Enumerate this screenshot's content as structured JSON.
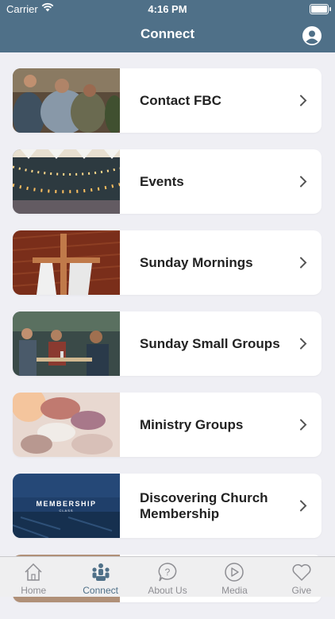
{
  "status_bar": {
    "carrier": "Carrier",
    "time": "4:16 PM"
  },
  "nav": {
    "title": "Connect",
    "profile_icon": "person-icon"
  },
  "items": [
    {
      "label": "Contact FBC",
      "image": "people-hugging-photo"
    },
    {
      "label": "Events",
      "image": "string-lights-photo"
    },
    {
      "label": "Sunday Mornings",
      "image": "cross-on-wall-photo"
    },
    {
      "label": "Sunday Small Groups",
      "image": "people-at-table-photo"
    },
    {
      "label": "Ministry Groups",
      "image": "hands-together-photo"
    },
    {
      "label": "Discovering Church Membership",
      "image": "membership-class-photo",
      "image_text": "MEMBERSHIP",
      "image_subtext": "CLASS"
    }
  ],
  "tabs": [
    {
      "label": "Home",
      "icon": "home-icon",
      "active": false
    },
    {
      "label": "Connect",
      "icon": "people-group-icon",
      "active": true
    },
    {
      "label": "About Us",
      "icon": "question-bubble-icon",
      "active": false
    },
    {
      "label": "Media",
      "icon": "play-circle-icon",
      "active": false
    },
    {
      "label": "Give",
      "icon": "heart-icon",
      "active": false
    }
  ],
  "colors": {
    "header": "#4f7088",
    "active_tab": "#4f7088",
    "inactive_tab": "#8e8e93",
    "background": "#efeff4"
  }
}
